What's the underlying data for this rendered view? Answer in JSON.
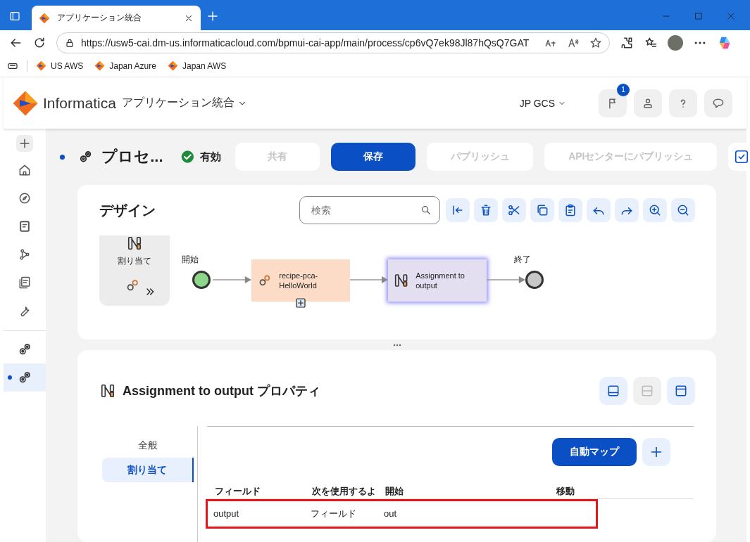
{
  "browser": {
    "tab_title": "アプリケーション統合",
    "url": "https://usw5-cai.dm-us.informaticacloud.com/bpmui-cai-app/main/process/cp6vQ7ek98Jl87hQsQ7GAT",
    "bookmarks": [
      {
        "label": "US AWS"
      },
      {
        "label": "Japan Azure"
      },
      {
        "label": "Japan AWS"
      }
    ]
  },
  "header": {
    "brand": "Informatica",
    "product": "アプリケーション統合",
    "org": "JP GCS",
    "notification_count": "1"
  },
  "sidebar": {
    "items": [
      {
        "kind": "plus"
      },
      {
        "kind": "home"
      },
      {
        "kind": "compass"
      },
      {
        "kind": "book"
      },
      {
        "kind": "network"
      },
      {
        "kind": "docs"
      },
      {
        "kind": "wrench"
      }
    ],
    "open_tabs": [
      {
        "selected": false
      },
      {
        "selected": true
      }
    ]
  },
  "process_bar": {
    "title": "プロセ...",
    "status": "有効",
    "buttons": [
      {
        "label": "共有",
        "kind": "disabled"
      },
      {
        "label": "保存",
        "kind": "primary"
      },
      {
        "label": "パブリッシュ",
        "kind": "disabled"
      },
      {
        "label": "APIセンターにパブリッシュ",
        "kind": "disabled"
      }
    ]
  },
  "design": {
    "title": "デザイン",
    "search": {
      "placeholder": "検索"
    },
    "tools": [
      {
        "kind": "collapse"
      },
      {
        "kind": "delete"
      },
      {
        "kind": "cut"
      },
      {
        "kind": "copy"
      },
      {
        "kind": "paste"
      },
      {
        "kind": "undo"
      },
      {
        "kind": "redo"
      },
      {
        "kind": "zoom-in"
      },
      {
        "kind": "zoom-out"
      }
    ],
    "palette": [
      {
        "label": "割り当て"
      }
    ],
    "nodes": [
      {
        "kind": "start",
        "label": "開始"
      },
      {
        "kind": "service",
        "label": "recipe-pca-HelloWorld",
        "selected": false
      },
      {
        "kind": "assignment",
        "label": "Assignment to output",
        "selected": true
      },
      {
        "kind": "end",
        "label": "終了"
      }
    ]
  },
  "properties": {
    "title": "Assignment to output プロパティ",
    "layout_buttons": [
      {
        "kind": "bottom",
        "disabled": false
      },
      {
        "kind": "split",
        "disabled": true
      },
      {
        "kind": "top",
        "disabled": false
      }
    ],
    "tabs": [
      {
        "label": "全般",
        "selected": false
      },
      {
        "label": "割り当て",
        "selected": true
      }
    ],
    "auto_map": "自動マップ",
    "table": {
      "columns": [
        "フィールド",
        "次を使用するよ",
        "開始",
        "移動"
      ],
      "rows": [
        {
          "cells": [
            "output",
            "フィールド",
            "out"
          ],
          "highlighted": true
        }
      ]
    }
  }
}
